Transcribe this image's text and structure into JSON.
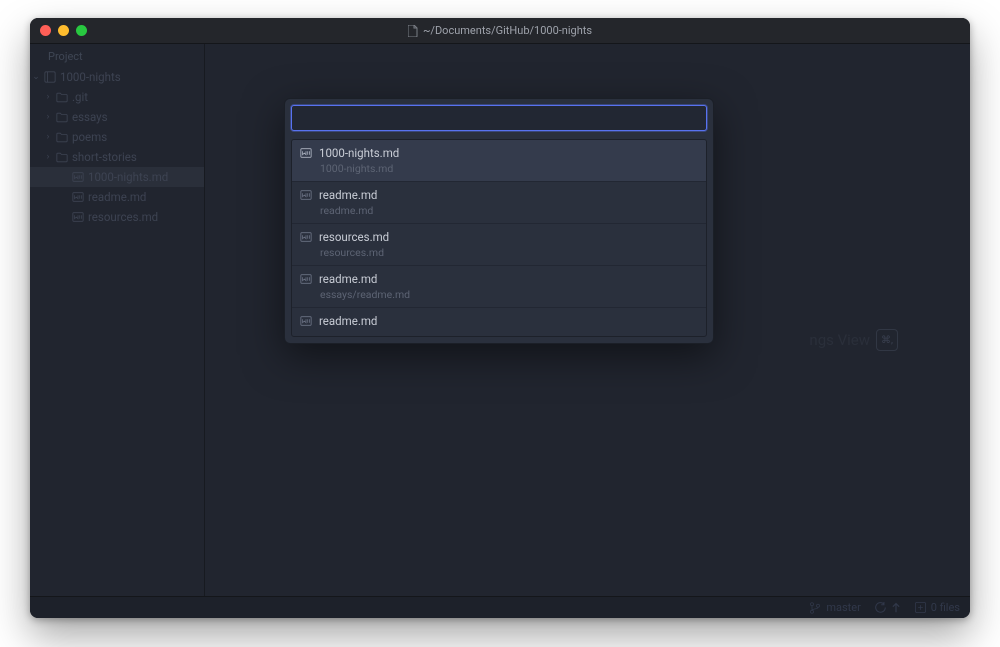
{
  "window": {
    "title": "~/Documents/GitHub/1000-nights"
  },
  "sidebar": {
    "header": "Project",
    "root": {
      "label": "1000-nights"
    },
    "items": [
      {
        "label": ".git",
        "icon": "folder",
        "indent": 1,
        "expandable": true
      },
      {
        "label": "essays",
        "icon": "folder",
        "indent": 1,
        "expandable": true
      },
      {
        "label": "poems",
        "icon": "folder",
        "indent": 1,
        "expandable": true
      },
      {
        "label": "short-stories",
        "icon": "folder",
        "indent": 1,
        "expandable": true
      },
      {
        "label": "1000-nights.md",
        "icon": "file-md",
        "indent": 2,
        "selected": true
      },
      {
        "label": "readme.md",
        "icon": "file-md",
        "indent": 2
      },
      {
        "label": "resources.md",
        "icon": "file-md",
        "indent": 2
      }
    ]
  },
  "finder": {
    "input_value": "",
    "results": [
      {
        "name": "1000-nights.md",
        "path": "1000-nights.md",
        "icon": "file-text",
        "selected": true
      },
      {
        "name": "readme.md",
        "path": "readme.md",
        "icon": "file-md"
      },
      {
        "name": "resources.md",
        "path": "resources.md",
        "icon": "file-md"
      },
      {
        "name": "readme.md",
        "path": "essays/readme.md",
        "icon": "file-md"
      },
      {
        "name": "readme.md",
        "path": "",
        "icon": "file-md"
      }
    ]
  },
  "background_hint": {
    "text": "ngs View",
    "key": "⌘,"
  },
  "statusbar": {
    "branch": "master",
    "fetch_icon": "sync",
    "push_icon": "arrow-up",
    "files_label": "0 files"
  }
}
